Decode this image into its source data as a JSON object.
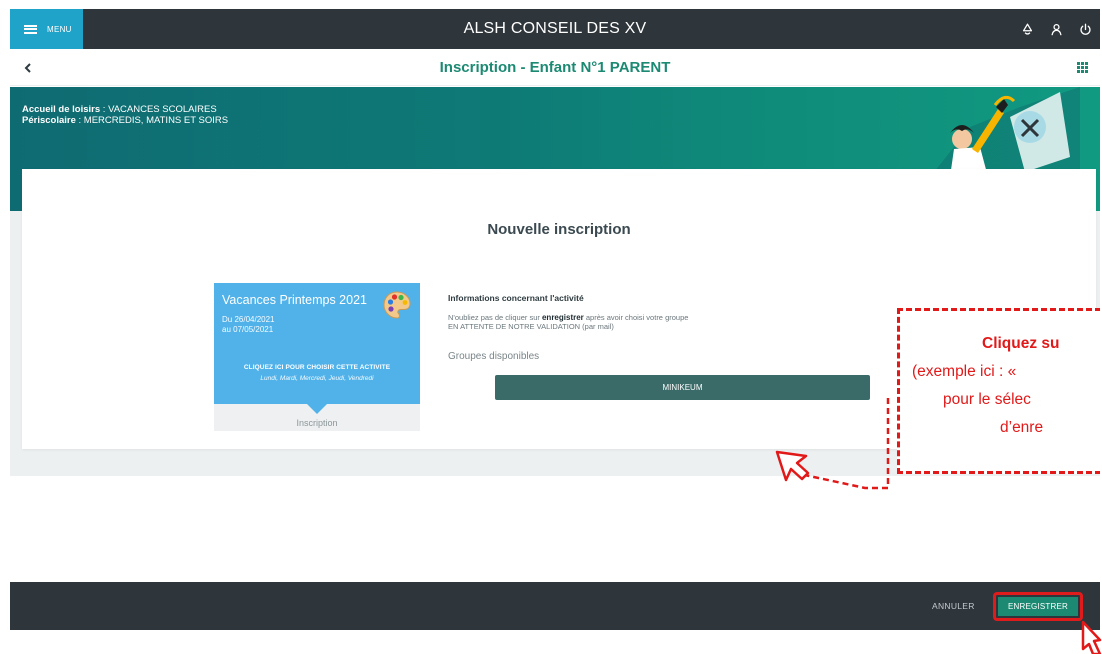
{
  "topbar": {
    "menu_label": "MENU",
    "app_title": "ALSH CONSEIL DES XV",
    "icons": [
      "bell-icon",
      "user-icon",
      "power-icon"
    ]
  },
  "subheader": {
    "back_icon": "chevron-left-icon",
    "title": "Inscription  -  Enfant N°1 PARENT",
    "grid_icon": "grid-icon"
  },
  "banner": {
    "line1_label": "Accueil de loisirs",
    "line1_value": " : VACANCES SCOLAIRES",
    "line2_label": "Périscolaire",
    "line2_value": " : MERCREDIS, MATINS ET SOIRS"
  },
  "main": {
    "title": "Nouvelle inscription",
    "activity": {
      "name": "Vacances Printemps 2021",
      "date_from": "Du 26/04/2021",
      "date_to": "au 07/05/2021",
      "cta": "CLIQUEZ ICI POUR CHOISIR CETTE ACTIVITE",
      "days": "Lundi, Mardi, Mercredi, Jeudi, Vendredi",
      "footer_label": "Inscription",
      "icon": "palette-icon"
    },
    "info": {
      "title": "Informations concernant l'activité",
      "line1_before": "N'oubliez pas de cliquer sur ",
      "line1_bold": "enregistrer",
      "line1_after": " après avoir choisi votre groupe",
      "line2": "EN ATTENTE DE NOTRE VALIDATION (par mail)",
      "groups_label": "Groupes disponibles",
      "groups": [
        "MINIKEUM"
      ]
    }
  },
  "footer": {
    "cancel_label": "ANNULER",
    "save_label": "ENREGISTRER"
  },
  "callout": {
    "line1": "Cliquez su",
    "line2": "(exemple ici : «",
    "line3": "pour le sélec",
    "line4": "d’enre"
  },
  "colors": {
    "accent_teal": "#1c8a73",
    "menu_blue": "#1fa3c9",
    "tile_blue": "#51b2ea",
    "annotation_red": "#e11919",
    "bar_dark": "#2e353b"
  }
}
